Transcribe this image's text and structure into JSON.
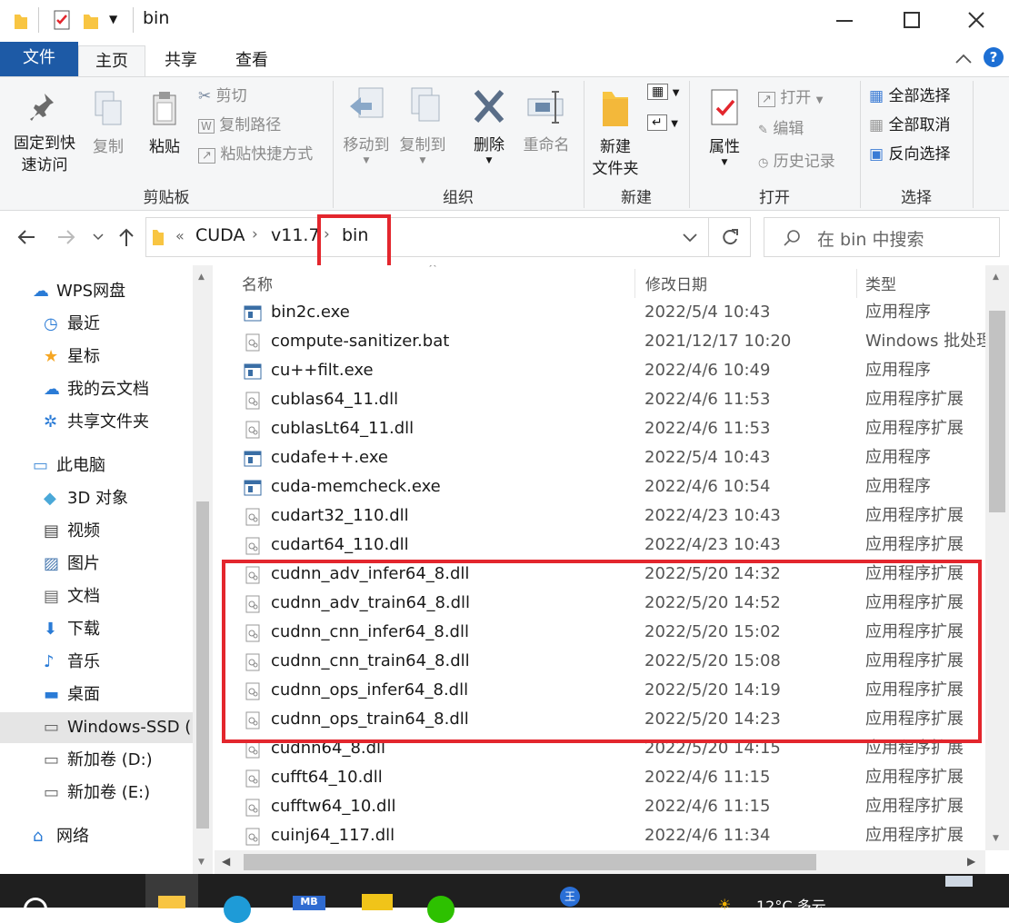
{
  "window": {
    "title": "bin"
  },
  "ribbon_tabs": [
    "文件",
    "主页",
    "共享",
    "查看"
  ],
  "ribbon": {
    "clipboard": {
      "pin": "固定到快\n速访问",
      "copy": "复制",
      "paste": "粘贴",
      "cut": "剪切",
      "copy_path": "复制路径",
      "paste_shortcut": "粘贴快捷方式",
      "label": "剪贴板"
    },
    "organize": {
      "move_to": "移动到",
      "copy_to": "复制到",
      "delete": "删除",
      "rename": "重命名",
      "label": "组织"
    },
    "new": {
      "new_folder": "新建\n文件夹",
      "label": "新建"
    },
    "open": {
      "properties": "属性",
      "open": "打开",
      "edit": "编辑",
      "history": "历史记录",
      "label": "打开"
    },
    "select": {
      "select_all": "全部选择",
      "select_none": "全部取消",
      "invert": "反向选择",
      "label": "选择"
    }
  },
  "address": {
    "overflow": "«",
    "crumbs": [
      "CUDA",
      "v11.7",
      "bin"
    ]
  },
  "search": {
    "placeholder": "在 bin 中搜索"
  },
  "nav": [
    {
      "label": "WPS网盘",
      "icon": "cloud-icon",
      "indent": 0
    },
    {
      "label": "最近",
      "icon": "clock-icon",
      "indent": 1
    },
    {
      "label": "星标",
      "icon": "star-icon",
      "indent": 1
    },
    {
      "label": "我的云文档",
      "icon": "cloud-doc-icon",
      "indent": 1
    },
    {
      "label": "共享文件夹",
      "icon": "share-icon",
      "indent": 1
    },
    {
      "label": "此电脑",
      "icon": "computer-icon",
      "indent": 0
    },
    {
      "label": "3D 对象",
      "icon": "cube-icon",
      "indent": 1
    },
    {
      "label": "视频",
      "icon": "video-icon",
      "indent": 1
    },
    {
      "label": "图片",
      "icon": "picture-icon",
      "indent": 1
    },
    {
      "label": "文档",
      "icon": "document-icon",
      "indent": 1
    },
    {
      "label": "下载",
      "icon": "download-icon",
      "indent": 1
    },
    {
      "label": "音乐",
      "icon": "music-icon",
      "indent": 1
    },
    {
      "label": "桌面",
      "icon": "desktop-icon",
      "indent": 1
    },
    {
      "label": "Windows-SSD (",
      "icon": "drive-icon",
      "indent": 1
    },
    {
      "label": "新加卷 (D:)",
      "icon": "drive-icon",
      "indent": 1
    },
    {
      "label": "新加卷 (E:)",
      "icon": "drive-icon",
      "indent": 1
    },
    {
      "label": "网络",
      "icon": "network-icon",
      "indent": 0
    }
  ],
  "columns": {
    "name": "名称",
    "date": "修改日期",
    "type": "类型"
  },
  "files": [
    {
      "name": "bin2c.exe",
      "date": "2022/5/4 10:43",
      "type": "应用程序",
      "kind": "exe"
    },
    {
      "name": "compute-sanitizer.bat",
      "date": "2021/12/17 10:20",
      "type": "Windows 批处理",
      "kind": "bat"
    },
    {
      "name": "cu++filt.exe",
      "date": "2022/4/6 10:49",
      "type": "应用程序",
      "kind": "exe"
    },
    {
      "name": "cublas64_11.dll",
      "date": "2022/4/6 11:53",
      "type": "应用程序扩展",
      "kind": "dll"
    },
    {
      "name": "cublasLt64_11.dll",
      "date": "2022/4/6 11:53",
      "type": "应用程序扩展",
      "kind": "dll"
    },
    {
      "name": "cudafe++.exe",
      "date": "2022/5/4 10:43",
      "type": "应用程序",
      "kind": "exe"
    },
    {
      "name": "cuda-memcheck.exe",
      "date": "2022/4/6 10:54",
      "type": "应用程序",
      "kind": "exe"
    },
    {
      "name": "cudart32_110.dll",
      "date": "2022/4/23 10:43",
      "type": "应用程序扩展",
      "kind": "dll"
    },
    {
      "name": "cudart64_110.dll",
      "date": "2022/4/23 10:43",
      "type": "应用程序扩展",
      "kind": "dll"
    },
    {
      "name": "cudnn_adv_infer64_8.dll",
      "date": "2022/5/20 14:32",
      "type": "应用程序扩展",
      "kind": "dll"
    },
    {
      "name": "cudnn_adv_train64_8.dll",
      "date": "2022/5/20 14:52",
      "type": "应用程序扩展",
      "kind": "dll"
    },
    {
      "name": "cudnn_cnn_infer64_8.dll",
      "date": "2022/5/20 15:02",
      "type": "应用程序扩展",
      "kind": "dll"
    },
    {
      "name": "cudnn_cnn_train64_8.dll",
      "date": "2022/5/20 15:08",
      "type": "应用程序扩展",
      "kind": "dll"
    },
    {
      "name": "cudnn_ops_infer64_8.dll",
      "date": "2022/5/20 14:19",
      "type": "应用程序扩展",
      "kind": "dll"
    },
    {
      "name": "cudnn_ops_train64_8.dll",
      "date": "2022/5/20 14:23",
      "type": "应用程序扩展",
      "kind": "dll"
    },
    {
      "name": "cudnn64_8.dll",
      "date": "2022/5/20 14:15",
      "type": "应用程序扩展",
      "kind": "dll"
    },
    {
      "name": "cufft64_10.dll",
      "date": "2022/4/6 11:15",
      "type": "应用程序扩展",
      "kind": "dll"
    },
    {
      "name": "cufftw64_10.dll",
      "date": "2022/4/6 11:15",
      "type": "应用程序扩展",
      "kind": "dll"
    },
    {
      "name": "cuinj64_117.dll",
      "date": "2022/4/6 11:34",
      "type": "应用程序扩展",
      "kind": "dll"
    }
  ],
  "taskbar": {
    "weather": "12°C 多云"
  },
  "colors": {
    "accent": "#1d5aa6",
    "highlight": "#e3262d",
    "folder": "#f8c542"
  }
}
